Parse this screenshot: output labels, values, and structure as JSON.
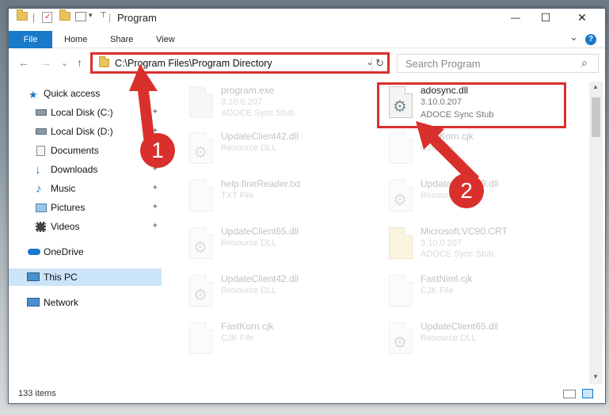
{
  "window": {
    "title": "Program",
    "minimize": "—",
    "maximize": "☐",
    "close": "✕"
  },
  "ribbon": {
    "file": "File",
    "tabs": [
      "Home",
      "Share",
      "View"
    ],
    "expand": "⌄",
    "help": "?"
  },
  "nav": {
    "back": "←",
    "forward": "→",
    "recent": "⌄",
    "up": "↑",
    "address": "C:\\Program Files\\Program Directory",
    "address_dropdown": "⌄",
    "refresh": "↻",
    "search_placeholder": "Search Program",
    "search_icon": "⌕"
  },
  "sidebar": {
    "items": [
      {
        "label": "Quick access",
        "icon": "star-icon",
        "pinned": false
      },
      {
        "label": "Local Disk (C:)",
        "icon": "drive-icon",
        "pinned": true
      },
      {
        "label": "Local Disk (D:)",
        "icon": "drive-icon",
        "pinned": true
      },
      {
        "label": "Documents",
        "icon": "documents-icon",
        "pinned": true
      },
      {
        "label": "Downloads",
        "icon": "download-icon",
        "pinned": true
      },
      {
        "label": "Music",
        "icon": "music-icon",
        "pinned": true
      },
      {
        "label": "Pictures",
        "icon": "pictures-icon",
        "pinned": true
      },
      {
        "label": "Videos",
        "icon": "videos-icon",
        "pinned": true
      },
      {
        "label": "OneDrive",
        "icon": "cloud-icon",
        "pinned": false
      },
      {
        "label": "This PC",
        "icon": "computer-icon",
        "pinned": false,
        "selected": true
      },
      {
        "label": "Network",
        "icon": "network-icon",
        "pinned": false
      }
    ],
    "pin_glyph": "📌"
  },
  "files": {
    "left": [
      {
        "name": "program.exe",
        "line2": "3.10.0.207",
        "line3": "ADOCE Sync Stub"
      },
      {
        "name": "UpdateClient42.dll",
        "line2": "Resource DLL",
        "line3": ""
      },
      {
        "name": "help.fineReader.txt",
        "line2": "TXT File",
        "line3": ""
      },
      {
        "name": "UpdateClient65.dll",
        "line2": "Resource DLL",
        "line3": ""
      },
      {
        "name": "UpdateClient42.dll",
        "line2": "Resource DLL",
        "line3": ""
      },
      {
        "name": "FastKorn.cjk",
        "line2": "CJK File",
        "line3": ""
      }
    ],
    "right": [
      {
        "name": "adosync.dll",
        "line2": "3.10.0.207",
        "line3": "ADOCE Sync Stub",
        "highlight": true
      },
      {
        "name": "FastKorn.cjk",
        "line2": "CJK File",
        "line3": ""
      },
      {
        "name": "UpdateClient19.dll",
        "line2": "Resource DLL",
        "line3": ""
      },
      {
        "name": "Microsoft.VC90.CRT",
        "line2": "3.10.0.207",
        "line3": "ADOCE Sync Stub"
      },
      {
        "name": "FastNiml.cjk",
        "line2": "CJK File",
        "line3": ""
      },
      {
        "name": "UpdateClient65.dll",
        "line2": "Resource DLL",
        "line3": ""
      }
    ]
  },
  "status": {
    "count": "133 items"
  },
  "callouts": {
    "one": "1",
    "two": "2"
  },
  "colors": {
    "accent": "#1979ca",
    "highlight": "#d9302d",
    "selected": "#cce4f7"
  }
}
